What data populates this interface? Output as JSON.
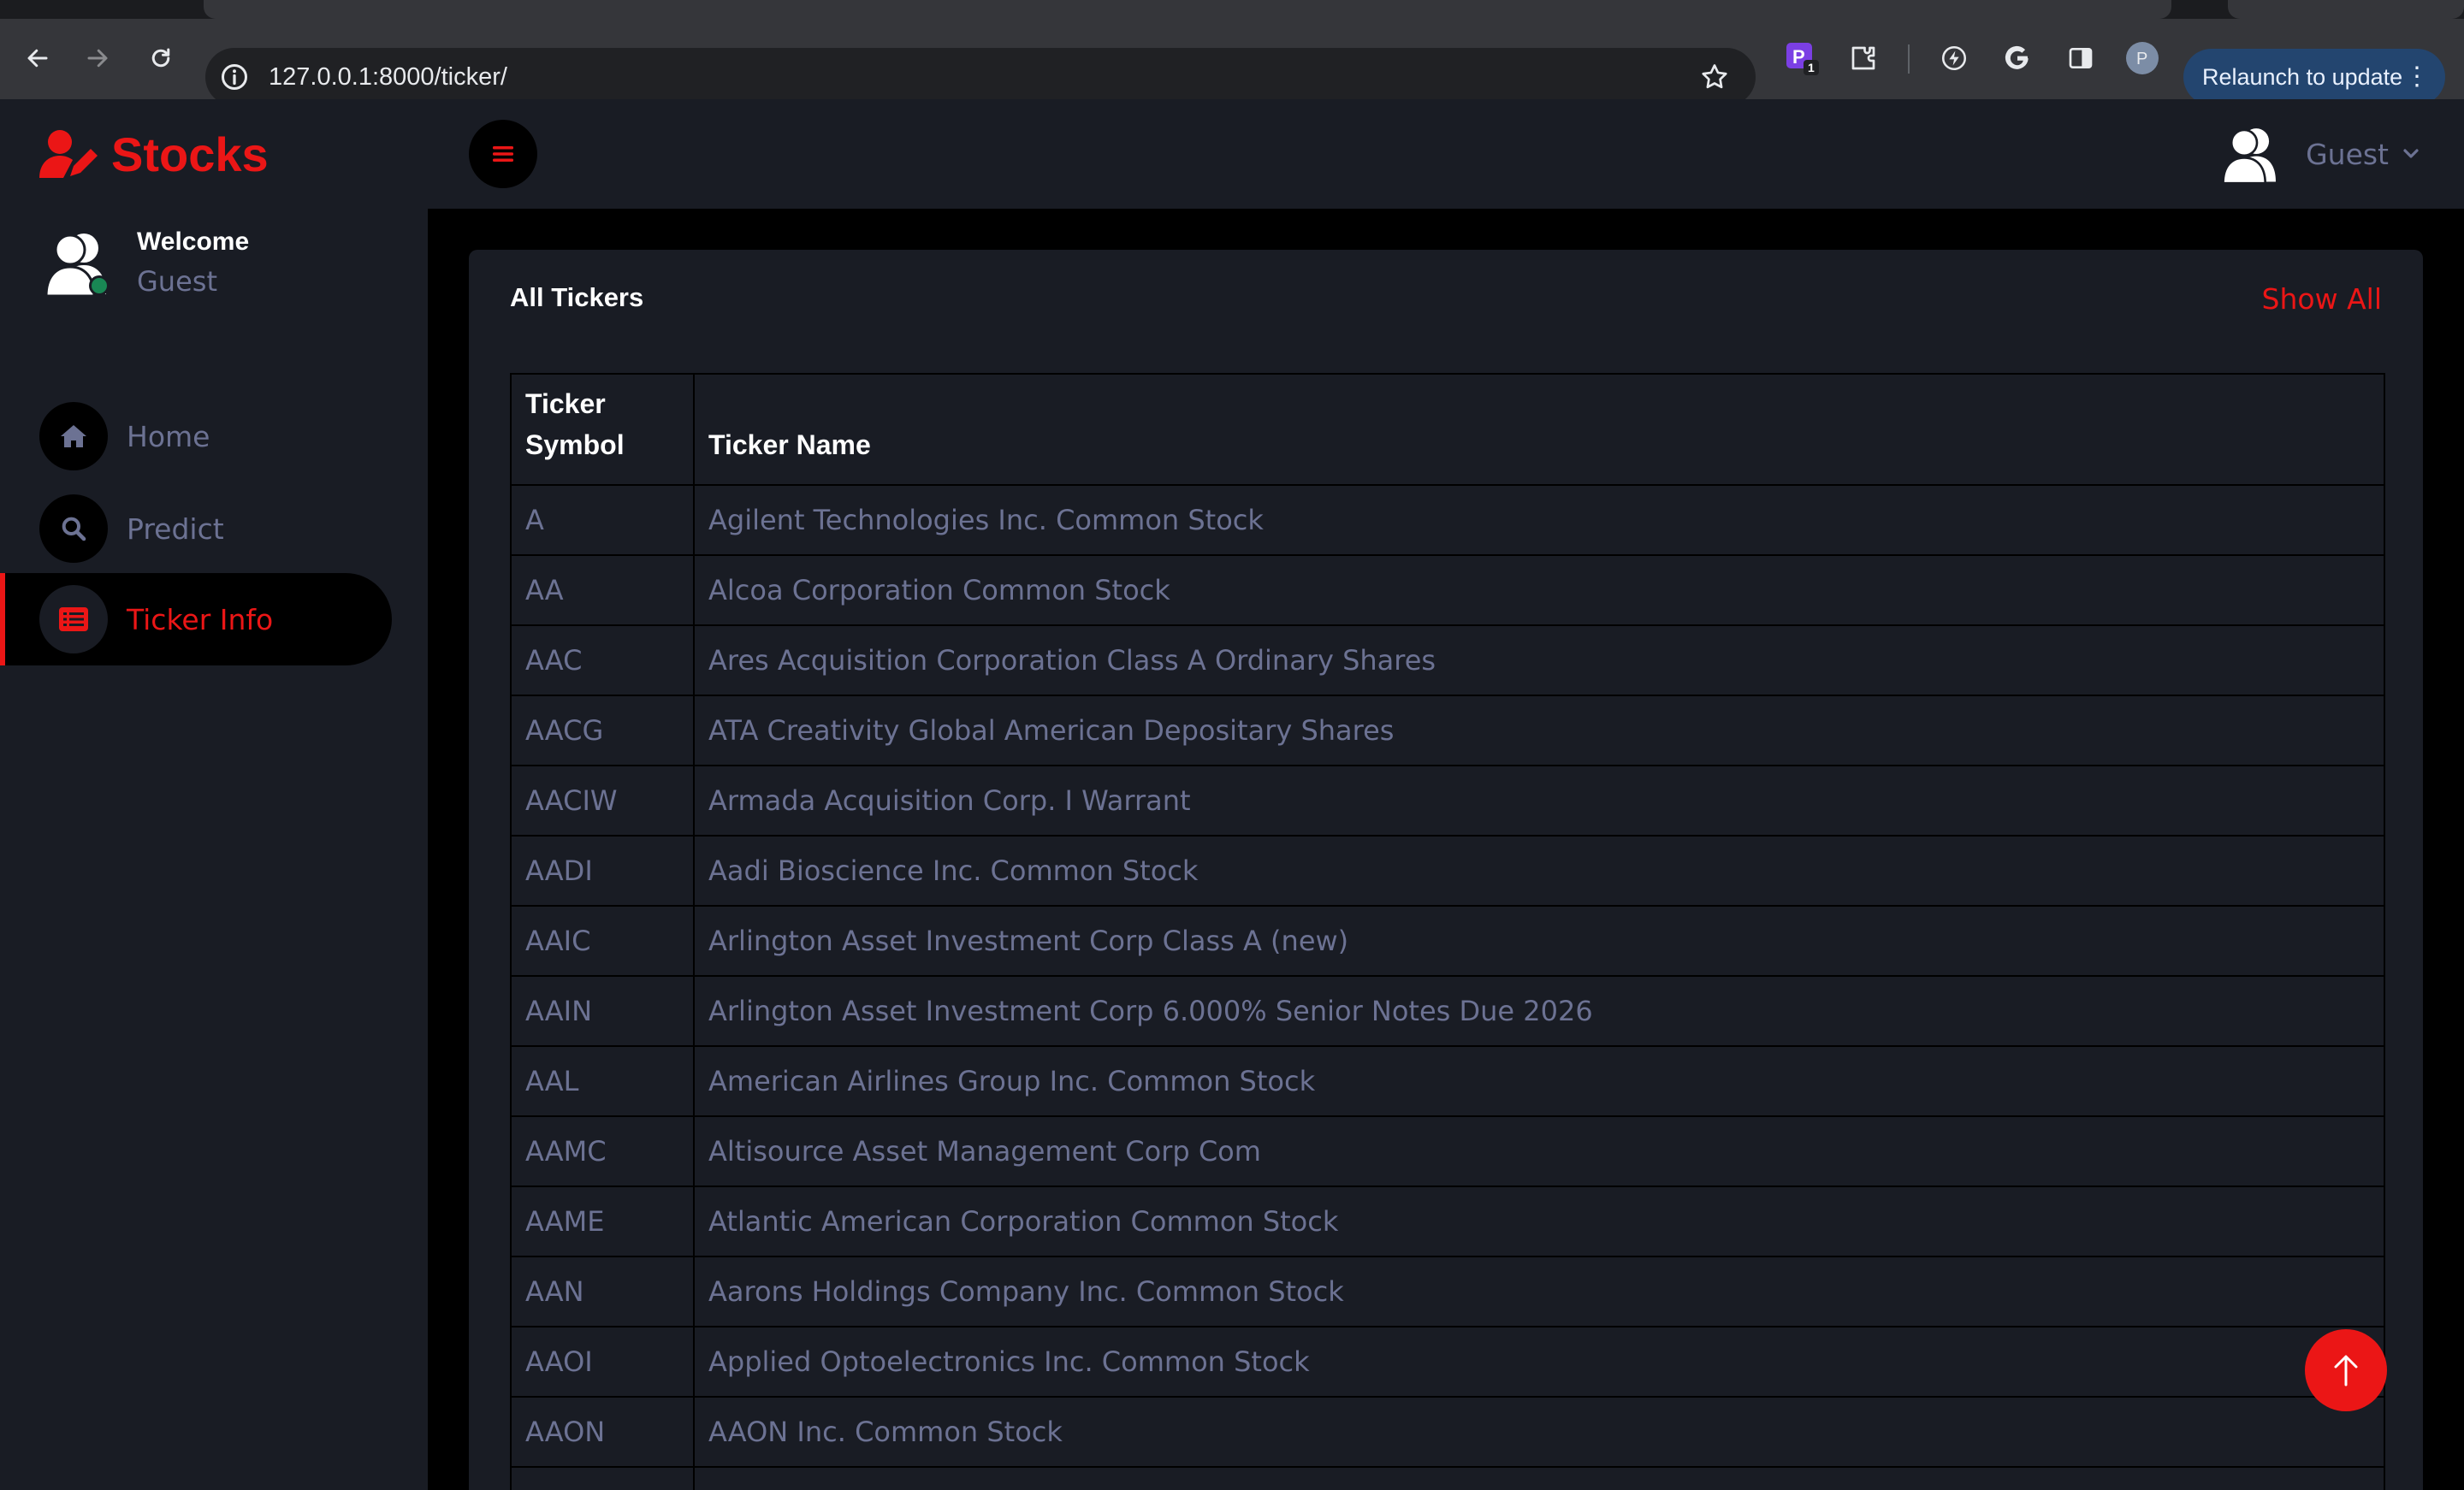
{
  "browser": {
    "url": "127.0.0.1:8000/ticker/",
    "extension_badge": "1",
    "profile_initial": "P",
    "relaunch_label": "Relaunch to update"
  },
  "app": {
    "brand": "Stocks",
    "welcome": "Welcome",
    "user_name": "Guest",
    "nav": [
      {
        "label": "Home",
        "icon": "home-icon"
      },
      {
        "label": "Predict",
        "icon": "search-icon"
      },
      {
        "label": "Ticker Info",
        "icon": "list-icon",
        "active": true
      }
    ],
    "header_user": "Guest"
  },
  "card": {
    "title": "All Tickers",
    "show_all": "Show All",
    "columns": [
      "Ticker Symbol",
      "Ticker Name"
    ],
    "rows": [
      [
        "A",
        "Agilent Technologies Inc. Common Stock"
      ],
      [
        "AA",
        "Alcoa Corporation Common Stock"
      ],
      [
        "AAC",
        "Ares Acquisition Corporation Class A Ordinary Shares"
      ],
      [
        "AACG",
        "ATA Creativity Global American Depositary Shares"
      ],
      [
        "AACIW",
        "Armada Acquisition Corp. I Warrant"
      ],
      [
        "AADI",
        "Aadi Bioscience Inc. Common Stock"
      ],
      [
        "AAIC",
        "Arlington Asset Investment Corp Class A (new)"
      ],
      [
        "AAIN",
        "Arlington Asset Investment Corp 6.000% Senior Notes Due 2026"
      ],
      [
        "AAL",
        "American Airlines Group Inc. Common Stock"
      ],
      [
        "AAMC",
        "Altisource Asset Management Corp Com"
      ],
      [
        "AAME",
        "Atlantic American Corporation Common Stock"
      ],
      [
        "AAN",
        "Aarons Holdings Company Inc. Common Stock"
      ],
      [
        "AAOI",
        "Applied Optoelectronics Inc. Common Stock"
      ],
      [
        "AAON",
        "AAON Inc. Common Stock"
      ],
      [
        "",
        ""
      ]
    ]
  },
  "colors": {
    "accent": "#eb1616",
    "panel": "#191c24",
    "background": "#000000",
    "muted_text": "#6c7293"
  }
}
